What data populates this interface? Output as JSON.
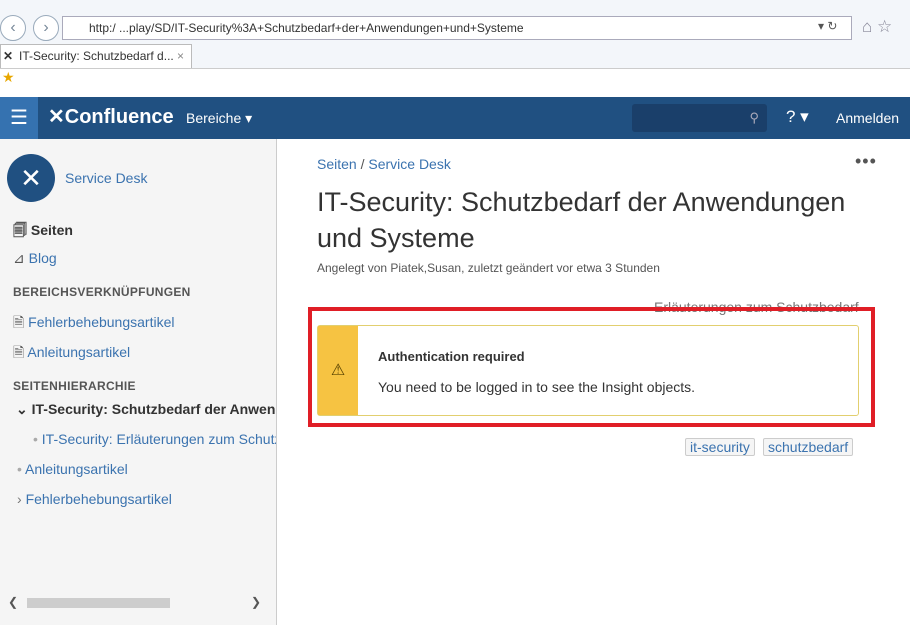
{
  "browser": {
    "url": "http:/            ...play/SD/IT-Security%3A+Schutzbedarf+der+Anwendungen+und+Systeme",
    "tab_title": "IT-Security: Schutzbedarf d...",
    "tab_close": "×"
  },
  "topnav": {
    "logo": "Confluence",
    "spaces": "Bereiche ▾",
    "help": "? ▾",
    "login": "Anmelden"
  },
  "sidebar": {
    "space_name": "Service Desk",
    "pages": "Seiten",
    "blog": "Blog",
    "links_heading": "BEREICHSVERKNÜPFUNGEN",
    "links": [
      "Fehlerbehebungsartikel",
      "Anleitungsartikel"
    ],
    "tree_heading": "SEITENHIERARCHIE",
    "tree": [
      {
        "label": "IT-Security: Schutzbedarf der Anwendungen und Systeme",
        "marker": "⌄"
      },
      {
        "label": "IT-Security: Erläuterungen zum Schutzbedarf",
        "marker": "•"
      },
      {
        "label": "Anleitungsartikel",
        "marker": "•"
      },
      {
        "label": "Fehlerbehebungsartikel",
        "marker": "›"
      }
    ]
  },
  "page": {
    "breadcrumb": [
      "Seiten",
      "Service Desk"
    ],
    "title": "IT-Security: Schutzbedarf der Anwendungen und Systeme",
    "meta": "Angelegt von Piatek,Susan, zuletzt geändert vor etwa 3 Stunden",
    "child_link": "Erläuterungen zum Schutzbedarf",
    "message": {
      "title": "Authentication required",
      "text": "You need to be logged in to see the Insight objects."
    },
    "labels": [
      "it-security",
      "schutzbedarf"
    ]
  },
  "colors": {
    "nav": "#205081",
    "warning": "#f6c342",
    "highlight": "#e01e26"
  }
}
